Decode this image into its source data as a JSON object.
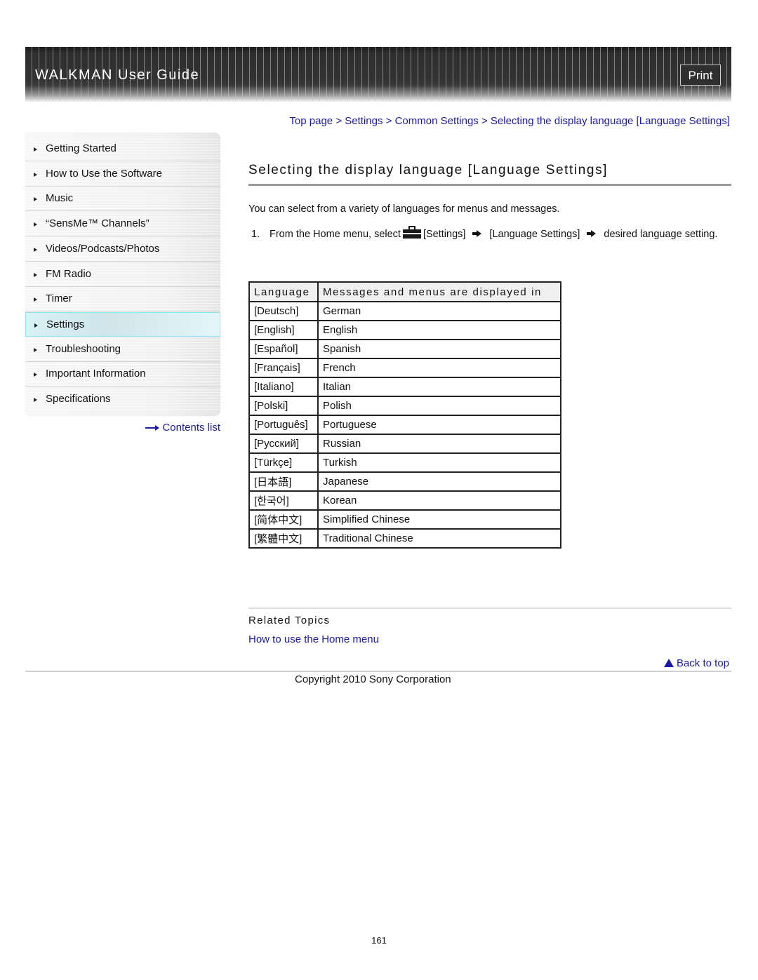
{
  "header": {
    "title": "WALKMAN User Guide",
    "print_label": "Print"
  },
  "breadcrumb": {
    "items": [
      "Top page",
      "Settings",
      "Common Settings",
      "Selecting the display language [Language Settings]"
    ],
    "separator": ">"
  },
  "sidebar": {
    "items": [
      {
        "label": "Getting Started",
        "active": false
      },
      {
        "label": "How to Use the Software",
        "active": false
      },
      {
        "label": "Music",
        "active": false
      },
      {
        "label": "“SensMe™ Channels”",
        "active": false
      },
      {
        "label": "Videos/Podcasts/Photos",
        "active": false
      },
      {
        "label": "FM Radio",
        "active": false
      },
      {
        "label": "Timer",
        "active": false
      },
      {
        "label": "Settings",
        "active": true
      },
      {
        "label": "Troubleshooting",
        "active": false
      },
      {
        "label": "Important Information",
        "active": false
      },
      {
        "label": "Specifications",
        "active": false
      }
    ],
    "contents_link": "Contents list",
    "active_color": "#8fe3f3"
  },
  "main": {
    "title": "Selecting the display language [Language Settings]",
    "intro": "You can select from a variety of languages for menus and messages.",
    "step": {
      "number": "1.",
      "text_before": "From the Home menu, select",
      "icon": "settings-toolbox-icon",
      "part1": "[Settings]",
      "part2": "[Language Settings]",
      "part3": "desired language setting."
    },
    "table": {
      "headers": [
        "Language",
        "Messages and menus are displayed in"
      ],
      "rows": [
        [
          "[Deutsch]",
          "German"
        ],
        [
          "[English]",
          "English"
        ],
        [
          "[Español]",
          "Spanish"
        ],
        [
          "[Français]",
          "French"
        ],
        [
          "[Italiano]",
          "Italian"
        ],
        [
          "[Polski]",
          "Polish"
        ],
        [
          "[Português]",
          "Portuguese"
        ],
        [
          "[Русский]",
          "Russian"
        ],
        [
          "[Türkçe]",
          "Turkish"
        ],
        [
          "[日本語]",
          "Japanese"
        ],
        [
          "[한국어]",
          "Korean"
        ],
        [
          "[简体中文]",
          "Simplified Chinese"
        ],
        [
          "[繁體中文]",
          "Traditional Chinese"
        ]
      ]
    },
    "related": {
      "title": "Related Topics",
      "links": [
        "How to use the Home menu"
      ]
    },
    "back_to_top": "Back to top"
  },
  "footer": {
    "copyright": "Copyright 2010 Sony Corporation",
    "page_number": "161"
  },
  "colors": {
    "link": "#1a1aa6",
    "header_bg": "#333333"
  }
}
